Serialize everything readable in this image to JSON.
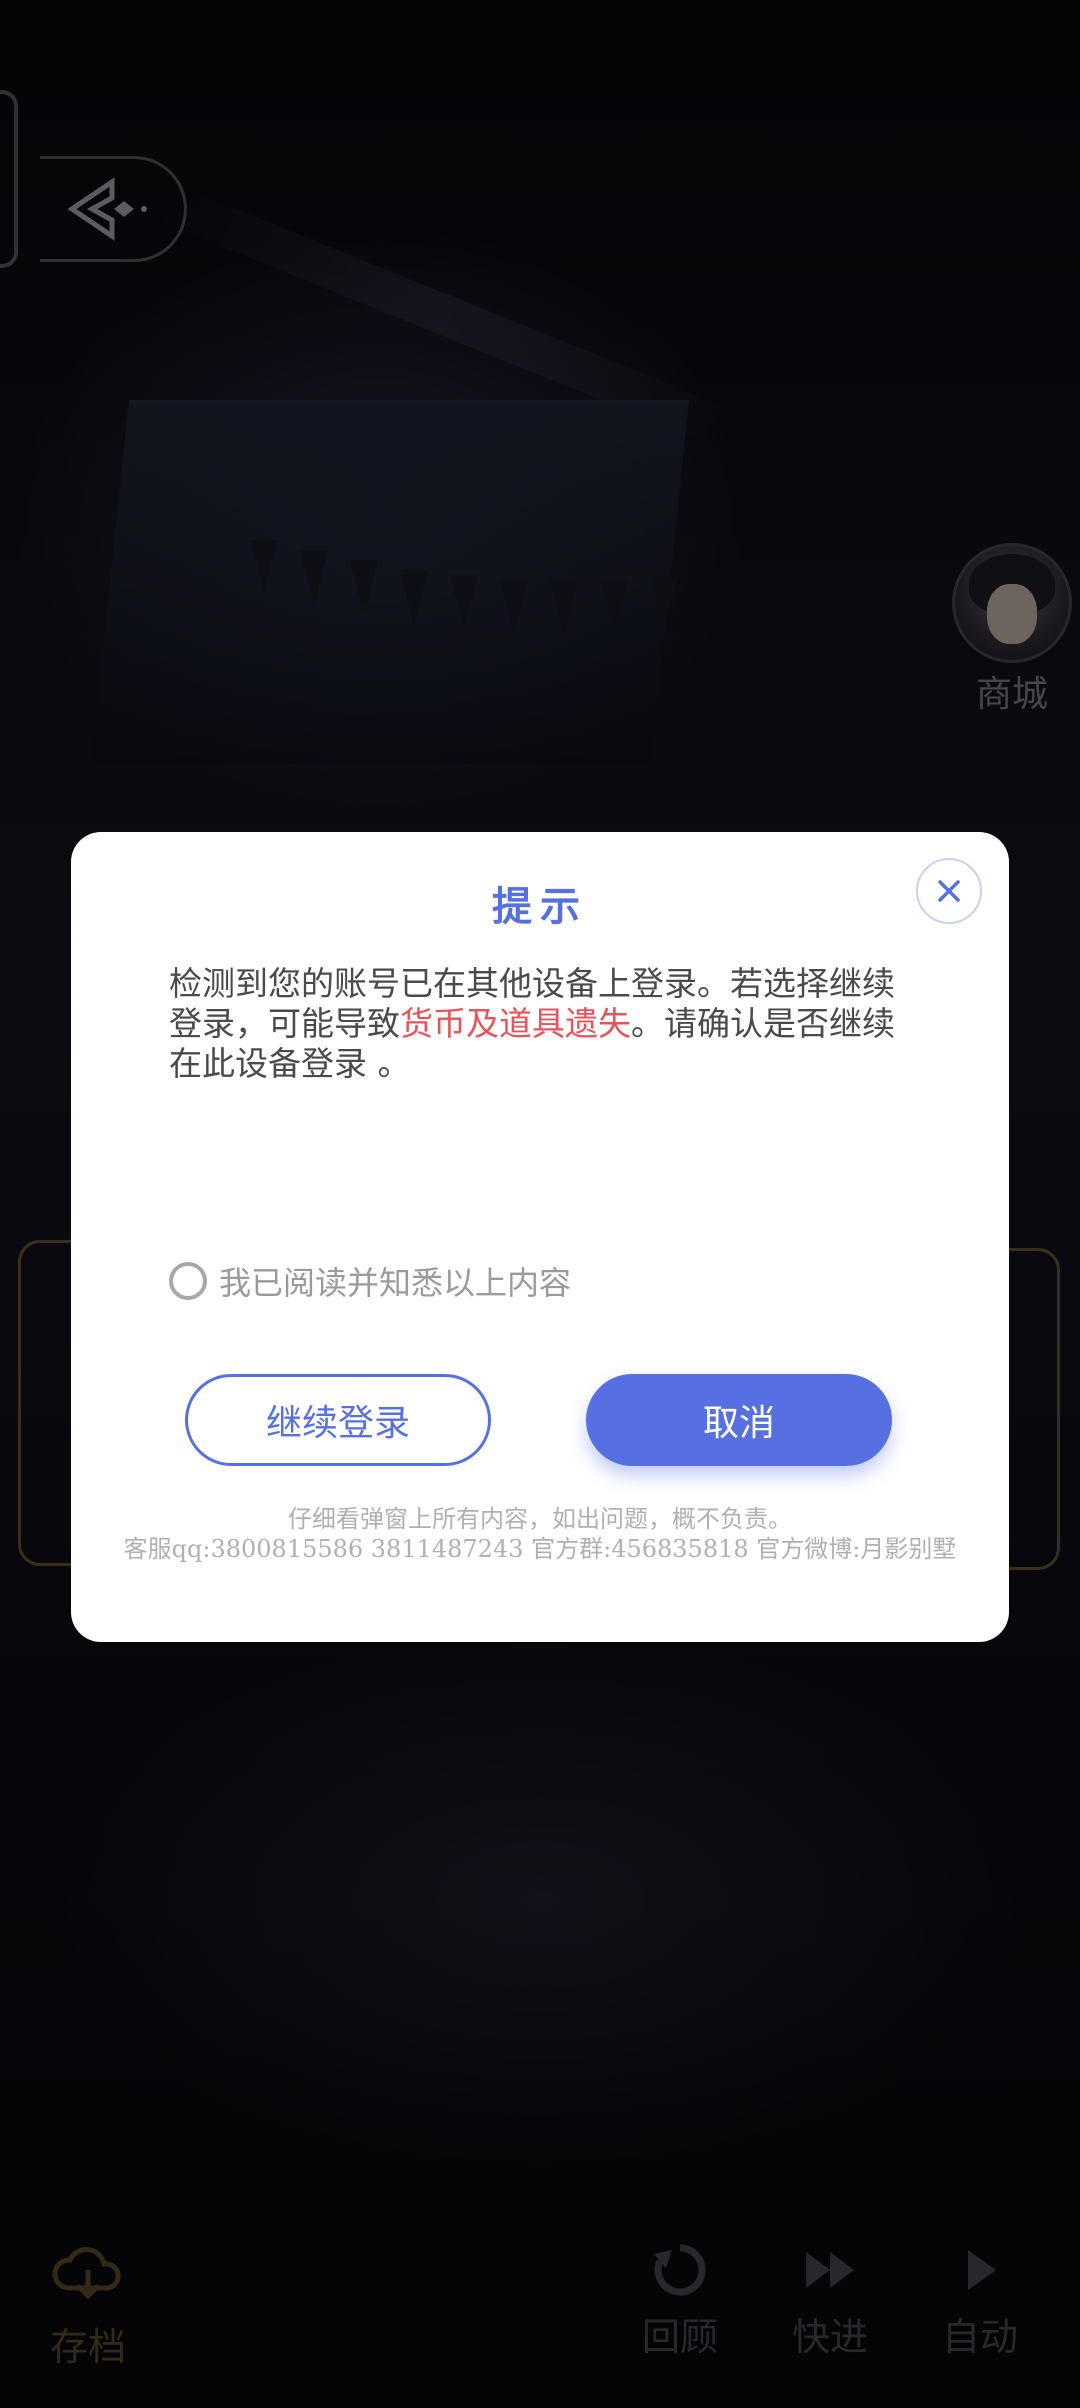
{
  "hud": {
    "shop_label": "商城",
    "bottom": {
      "save_label": "存档",
      "review_label": "回顾",
      "fast_forward_label": "快进",
      "auto_label": "自动"
    }
  },
  "dialog": {
    "title": "提示",
    "message_part1": "检测到您的账号已在其他设备上登录。若选择继续登录，可能导致",
    "message_warning": "货币及道具遗失",
    "message_part2": "。请确认是否继续在此设备登录 。",
    "agree_label": "我已阅读并知悉以上内容",
    "continue_button": "继续登录",
    "cancel_button": "取消",
    "footer_line1": "仔细看弹窗上所有内容，如出问题，概不负责。",
    "footer_line2": "客服qq:3800815586   3811487243 官方群:456835818 官方微博:月影别墅"
  },
  "colors": {
    "accent": "#5670e2",
    "warning": "#e8535b",
    "dialog_bg": "#ffffff"
  },
  "icons": [
    "back-icon",
    "shop-avatar",
    "close-icon",
    "cloud-save-icon",
    "review-icon",
    "fast-forward-icon",
    "play-icon"
  ]
}
